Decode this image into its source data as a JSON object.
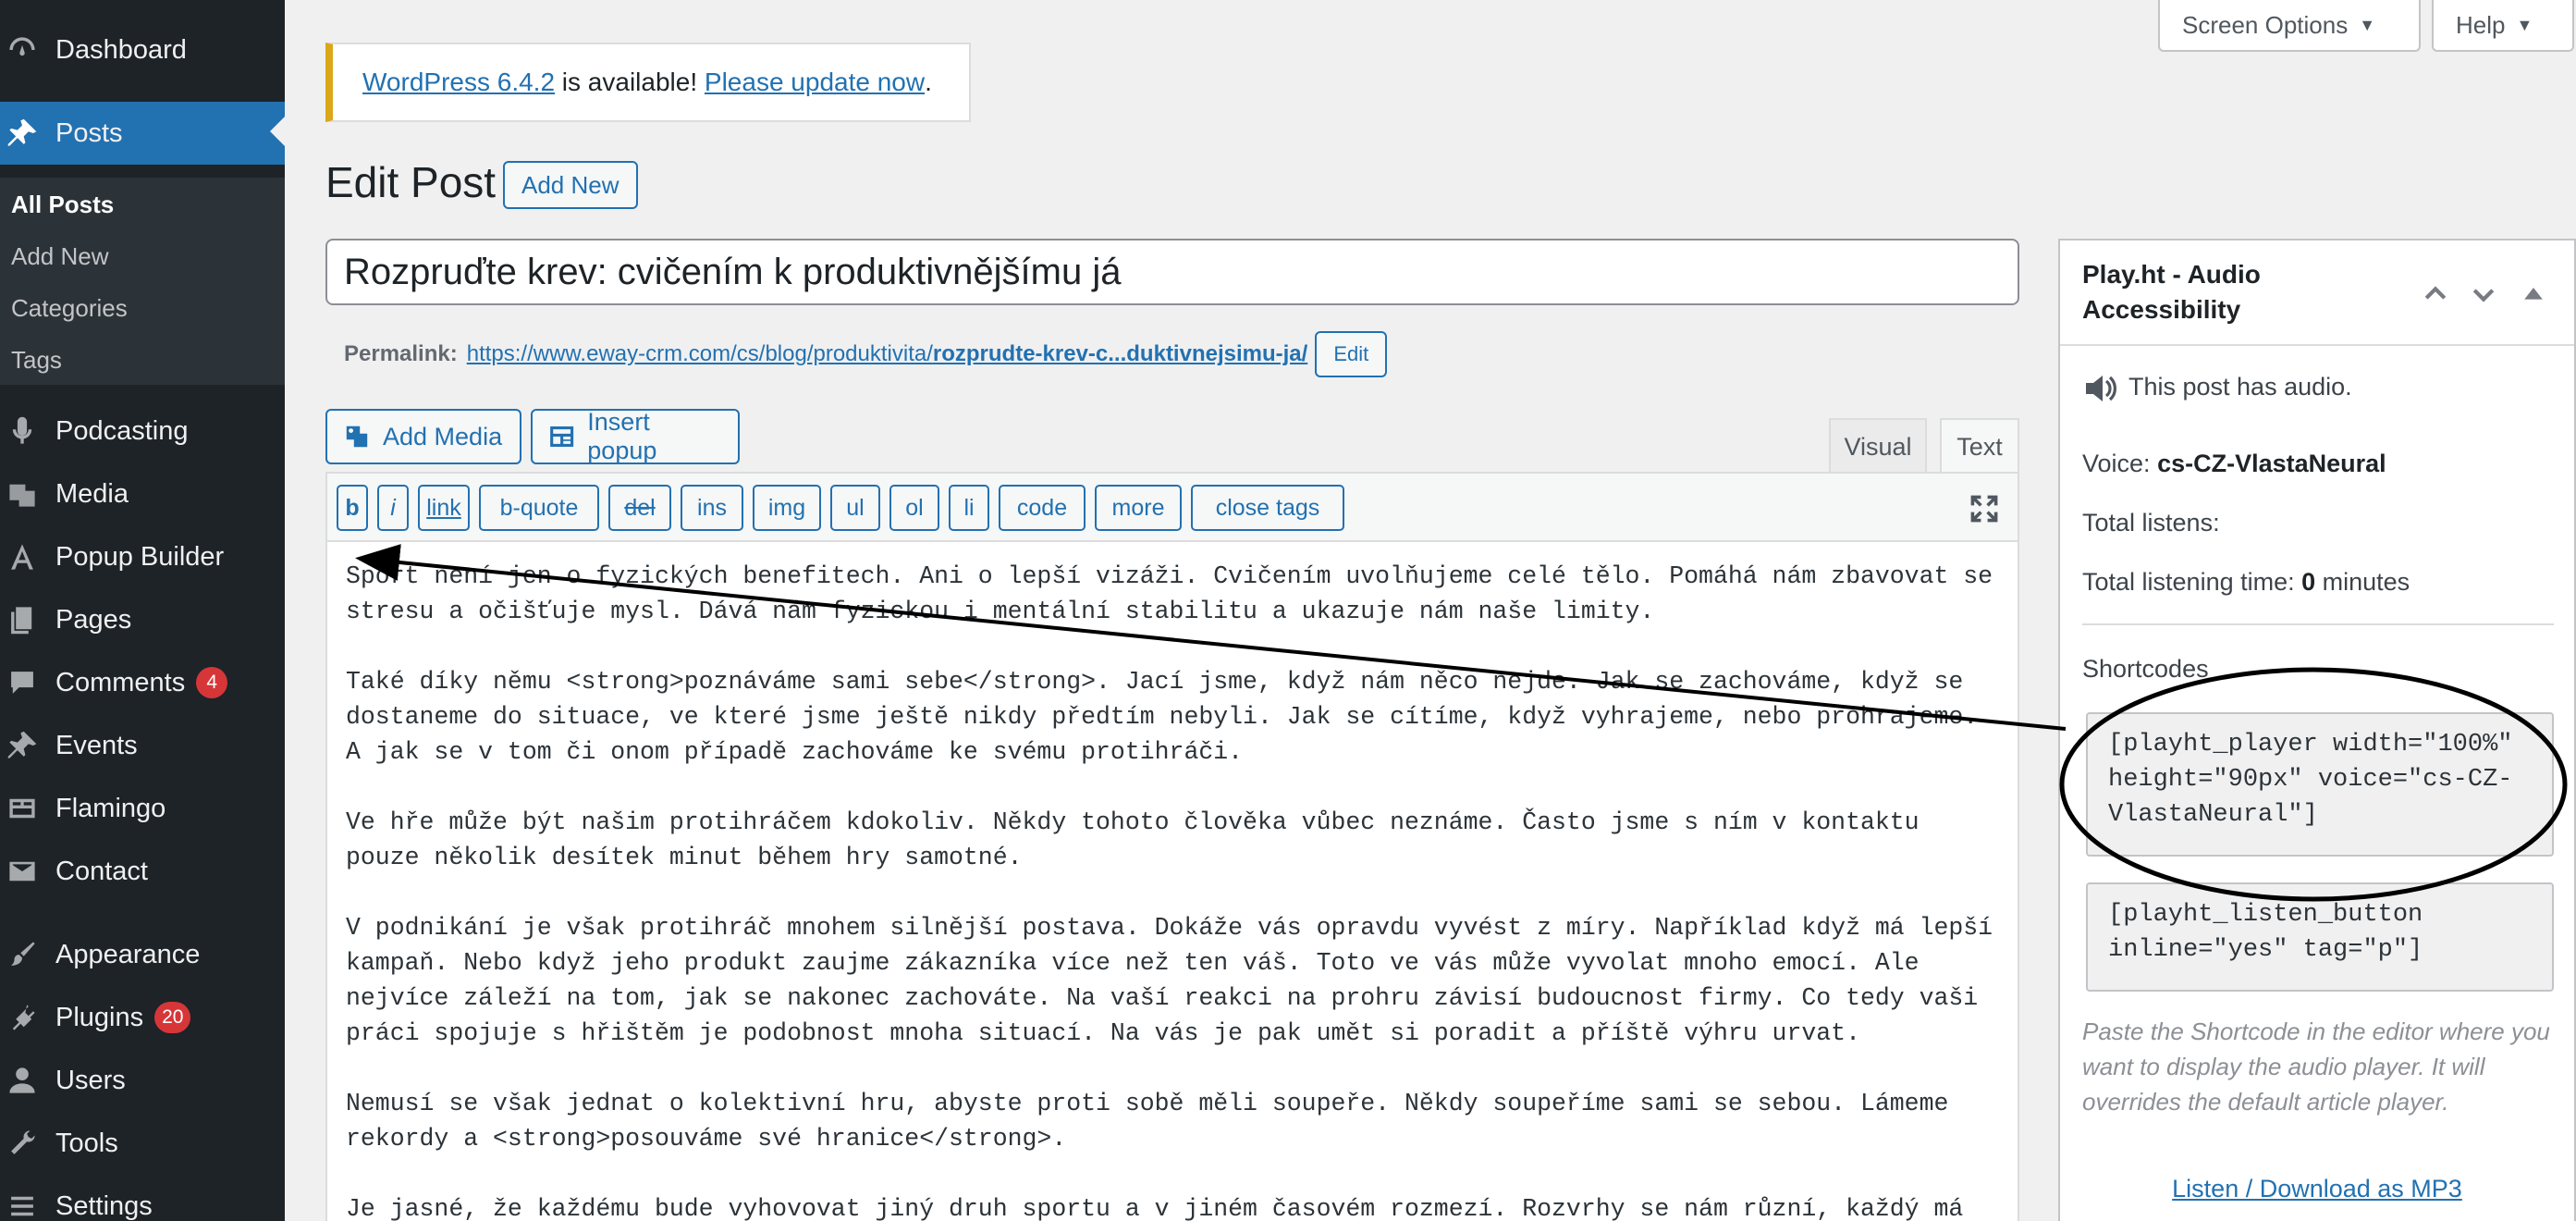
{
  "sidebar": {
    "items": [
      {
        "label": "Dashboard",
        "icon": "dashboard-icon"
      },
      {
        "label": "Posts",
        "icon": "pin-icon"
      },
      {
        "label": "Podcasting",
        "icon": "microphone-icon"
      },
      {
        "label": "Media",
        "icon": "media-icon"
      },
      {
        "label": "Popup Builder",
        "icon": "popup-builder-icon"
      },
      {
        "label": "Pages",
        "icon": "pages-icon"
      },
      {
        "label": "Comments",
        "icon": "comments-icon",
        "badge": "4"
      },
      {
        "label": "Events",
        "icon": "pin-icon"
      },
      {
        "label": "Flamingo",
        "icon": "flamingo-icon"
      },
      {
        "label": "Contact",
        "icon": "mail-icon"
      },
      {
        "label": "Appearance",
        "icon": "paintbrush-icon"
      },
      {
        "label": "Plugins",
        "icon": "plugin-icon",
        "badge": "20"
      },
      {
        "label": "Users",
        "icon": "users-icon"
      },
      {
        "label": "Tools",
        "icon": "wrench-icon"
      },
      {
        "label": "Settings",
        "icon": "settings-icon"
      }
    ],
    "posts_submenu": [
      "All Posts",
      "Add New",
      "Categories",
      "Tags"
    ]
  },
  "top_buttons": {
    "screen_options": "Screen Options",
    "help": "Help"
  },
  "notice": {
    "version_link": "WordPress 6.4.2",
    "middle": " is available! ",
    "update_link": "Please update now",
    "end": "."
  },
  "page": {
    "title": "Edit Post",
    "add_new": "Add New"
  },
  "post": {
    "title": "Rozpruďte krev: cvičením k produktivnějšímu já",
    "permalink_label": "Permalink:",
    "permalink_base": "https://www.eway-crm.com/cs/blog/produktivita/",
    "permalink_slug": "rozprudte-krev-c...duktivnejsimu-ja/",
    "permalink_edit": "Edit"
  },
  "editor": {
    "add_media": "Add Media",
    "insert_popup": "Insert popup",
    "tab_visual": "Visual",
    "tab_text": "Text",
    "quicktags": [
      "b",
      "i",
      "link",
      "b-quote",
      "del",
      "ins",
      "img",
      "ul",
      "ol",
      "li",
      "code",
      "more",
      "close tags"
    ],
    "paragraphs": [
      "Sport není jen o fyzických benefitech. Ani o lepší vizáži. Cvičením uvolňujeme celé tělo. Pomáhá nám zbavovat se stresu a očišťuje mysl. Dává nám fyzickou i mentální stabilitu a ukazuje nám naše limity.",
      "Také díky němu <strong>poznáváme sami sebe</strong>. Jací jsme, když nám něco nejde. Jak se zachováme, když se dostaneme do situace, ve které jsme ještě nikdy předtím nebyli. Jak se cítíme, když vyhrajeme, nebo prohrajeme. A jak se v tom či onom případě zachováme ke svému protihráči.",
      "Ve hře může být našim protihráčem kdokoliv. Někdy tohoto člověka vůbec neznáme. Často jsme s ním v kontaktu pouze několik desítek minut během hry samotné.",
      "V podnikání je však protihráč mnohem silnější postava. Dokáže vás opravdu vyvést z míry. Například když má lepší kampaň. Nebo když jeho produkt zaujme zákazníka více než ten váš. Toto ve vás může vyvolat mnoho emocí. Ale nejvíce záleží na tom, jak se nakonec zachováte. Na vaší reakci na prohru závisí budoucnost firmy. Co tedy vaši práci spojuje s hřištěm je podobnost mnoha situací. Na vás je pak umět si poradit a příště výhru urvat.",
      "Nemusí se však jednat o kolektivní hru, abyste proti sobě měli soupeře. Někdy soupeříme sami se sebou. Lámeme rekordy a <strong>posouváme své hranice</strong>.",
      "Je jasné, že každému bude vyhovovat jiný druh sportu a v jiném časovém rozmezí. Rozvrhy se nám různí, každý má"
    ]
  },
  "metabox": {
    "title": "Play.ht - Audio Accessibility",
    "has_audio": "This post has audio.",
    "voice_label": "Voice: ",
    "voice_value": "cs-CZ-VlastaNeural",
    "total_listens": "Total listens:",
    "listening_label": "Total listening time: ",
    "listening_value": "0",
    "listening_unit": " minutes",
    "shortcodes_label": "Shortcodes",
    "shortcode_player": "[playht_player width=\"100%\" height=\"90px\" voice=\"cs-CZ-VlastaNeural\"]",
    "shortcode_button": "[playht_listen_button inline=\"yes\" tag=\"p\"]",
    "help_text": "Paste the Shortcode in the editor where you want to display the audio player. It will overrides the default article player.",
    "download_link": "Listen / Download as MP3"
  },
  "colors": {
    "sidebar_bg": "#1d2327",
    "accent": "#2271b1",
    "badge": "#d63638",
    "notice_border": "#dba617"
  }
}
